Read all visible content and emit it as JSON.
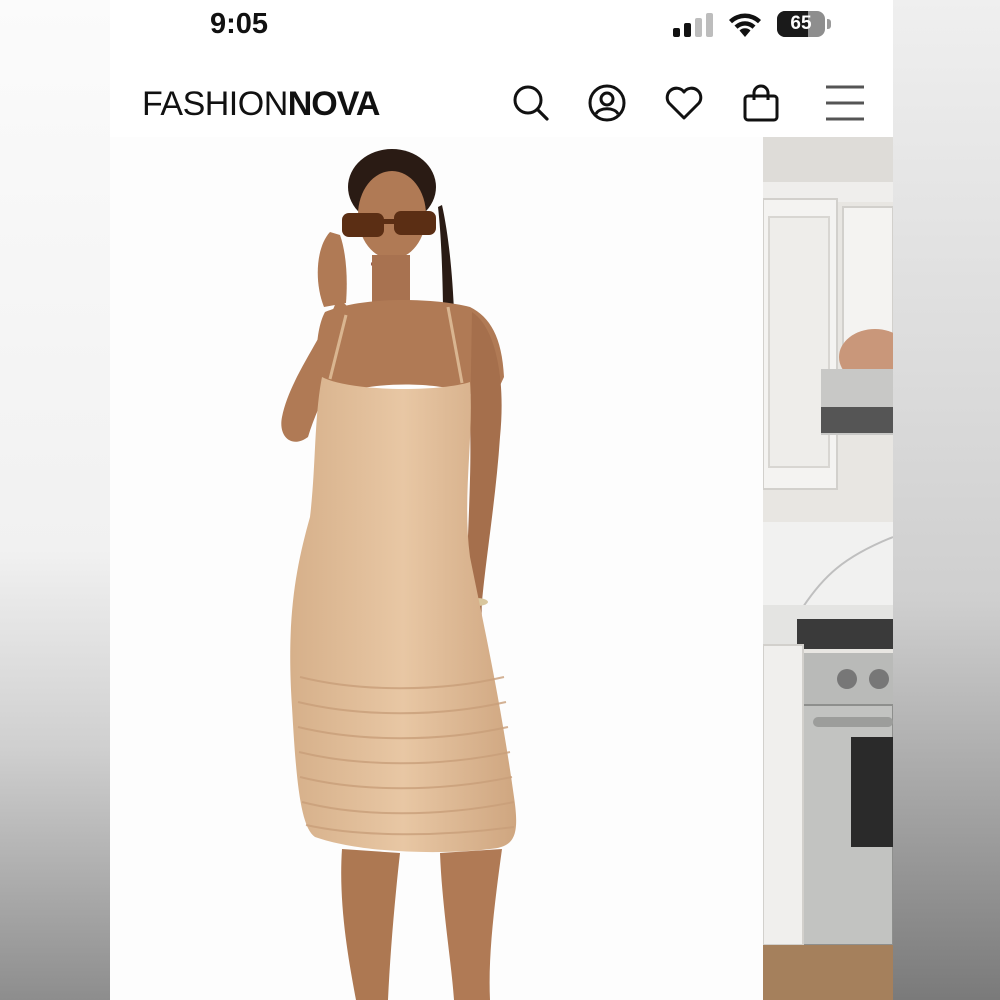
{
  "status_bar": {
    "time": "9:05",
    "battery_level": "65",
    "battery_fraction": 0.65,
    "icons": [
      "signal-icon",
      "wifi-icon",
      "battery-icon"
    ]
  },
  "header": {
    "logo_light": "FASHION",
    "logo_bold": "NOVA",
    "icons": [
      "search-icon",
      "account-icon",
      "wishlist-heart-icon",
      "shopping-bag-icon",
      "menu-icon"
    ]
  },
  "carousel": {
    "images": [
      "product-photo-model-nude-ruched-midi-dress",
      "product-photo-kitchen-partial"
    ]
  },
  "colors": {
    "dress": "#e3c09c",
    "skin": "#b07a55",
    "background": "#ffffff",
    "text": "#111111"
  }
}
